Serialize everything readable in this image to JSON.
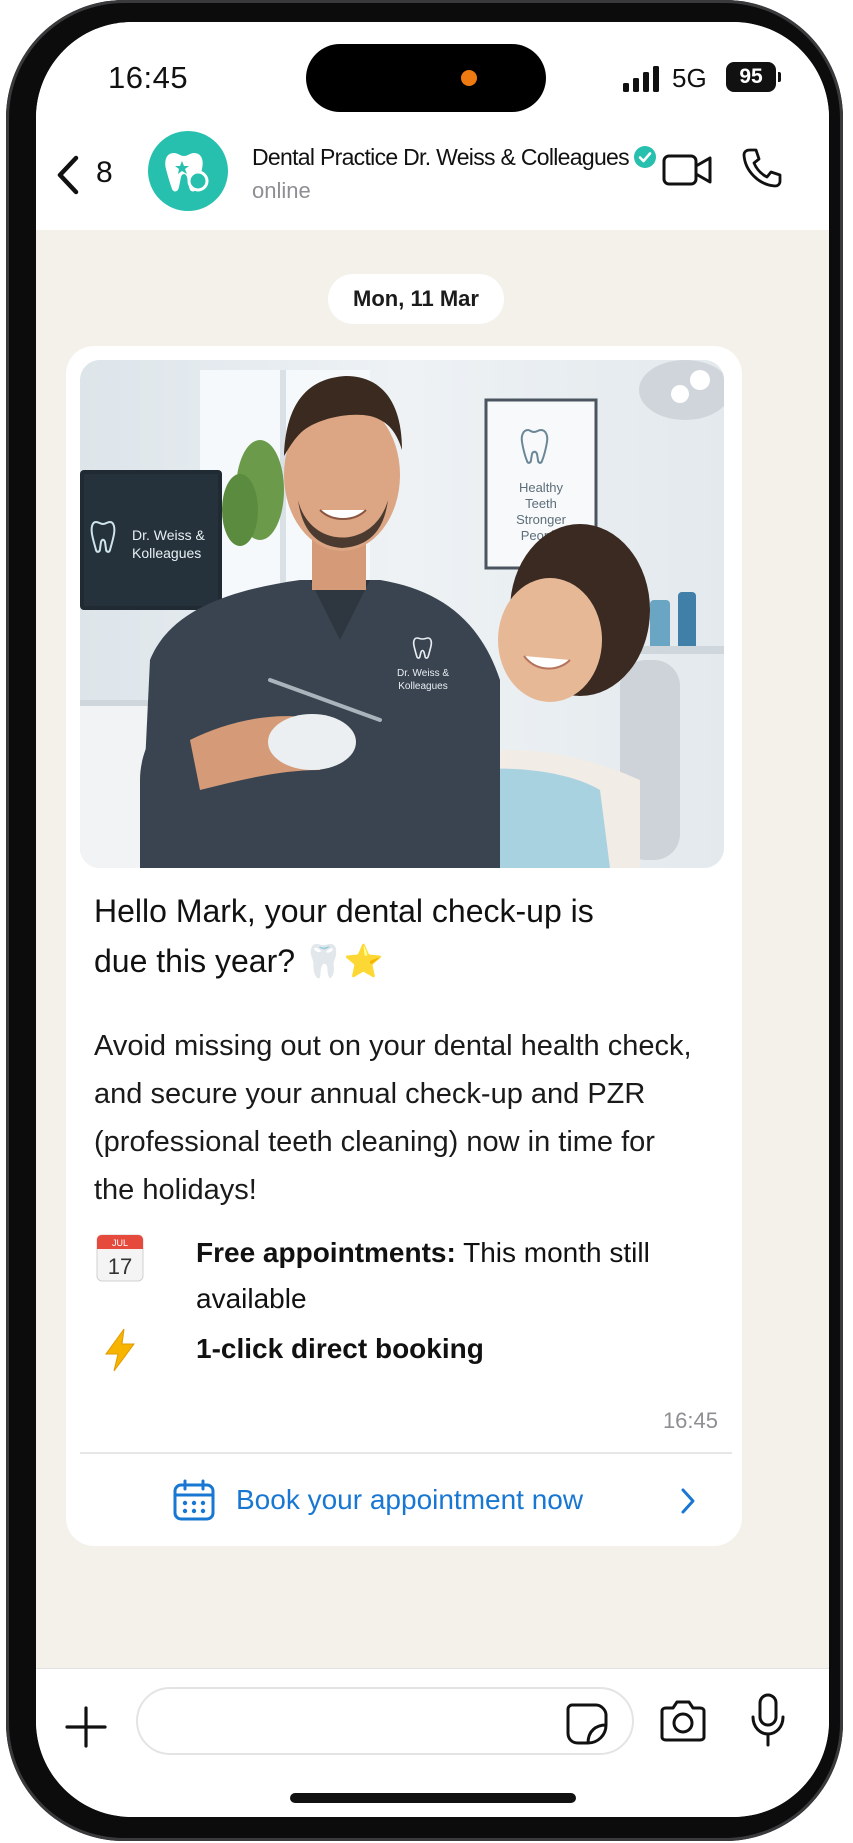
{
  "status_bar": {
    "time": "16:45",
    "network": "5G",
    "battery": "95"
  },
  "header": {
    "back_count": "8",
    "contact_name": "Dental Practice Dr. Weiss & Colleagues",
    "contact_status": "online",
    "accent_color": "#27c0ae",
    "icons": [
      "chevron-left-icon",
      "tooth-logo-icon",
      "verified-icon",
      "video-call-icon",
      "phone-call-icon"
    ]
  },
  "chat": {
    "date_label": "Mon, 11 Mar",
    "message": {
      "image": {
        "monitor_text_line1": "Dr. Weiss &",
        "monitor_text_line2": "Kolleagues",
        "poster_lines": [
          "Healthy",
          "Teeth",
          "Stronger",
          "People"
        ],
        "shirt_logo_line1": "Dr. Weiss &",
        "shirt_logo_line2": "Kolleagues"
      },
      "headline": "Hello Mark, your dental check-up is due this year? 🦷⭐",
      "body": "Avoid missing out on your dental health check, and secure your annual check-up and PZR (professional teeth cleaning) now in time for the holidays!",
      "features": [
        {
          "icon": "calendar-icon",
          "icon_month": "JUL",
          "icon_day": "17",
          "bold": "Free appointments:",
          "text": " This month still available"
        },
        {
          "icon": "lightning-icon",
          "bold": "1-click direct booking",
          "text": ""
        }
      ],
      "time": "16:45",
      "cta_label": "Book your appointment now",
      "cta_color": "#1877d2"
    }
  },
  "input_bar": {
    "icons": [
      "plus-icon",
      "sticker-icon",
      "camera-icon",
      "microphone-icon"
    ],
    "placeholder": ""
  }
}
